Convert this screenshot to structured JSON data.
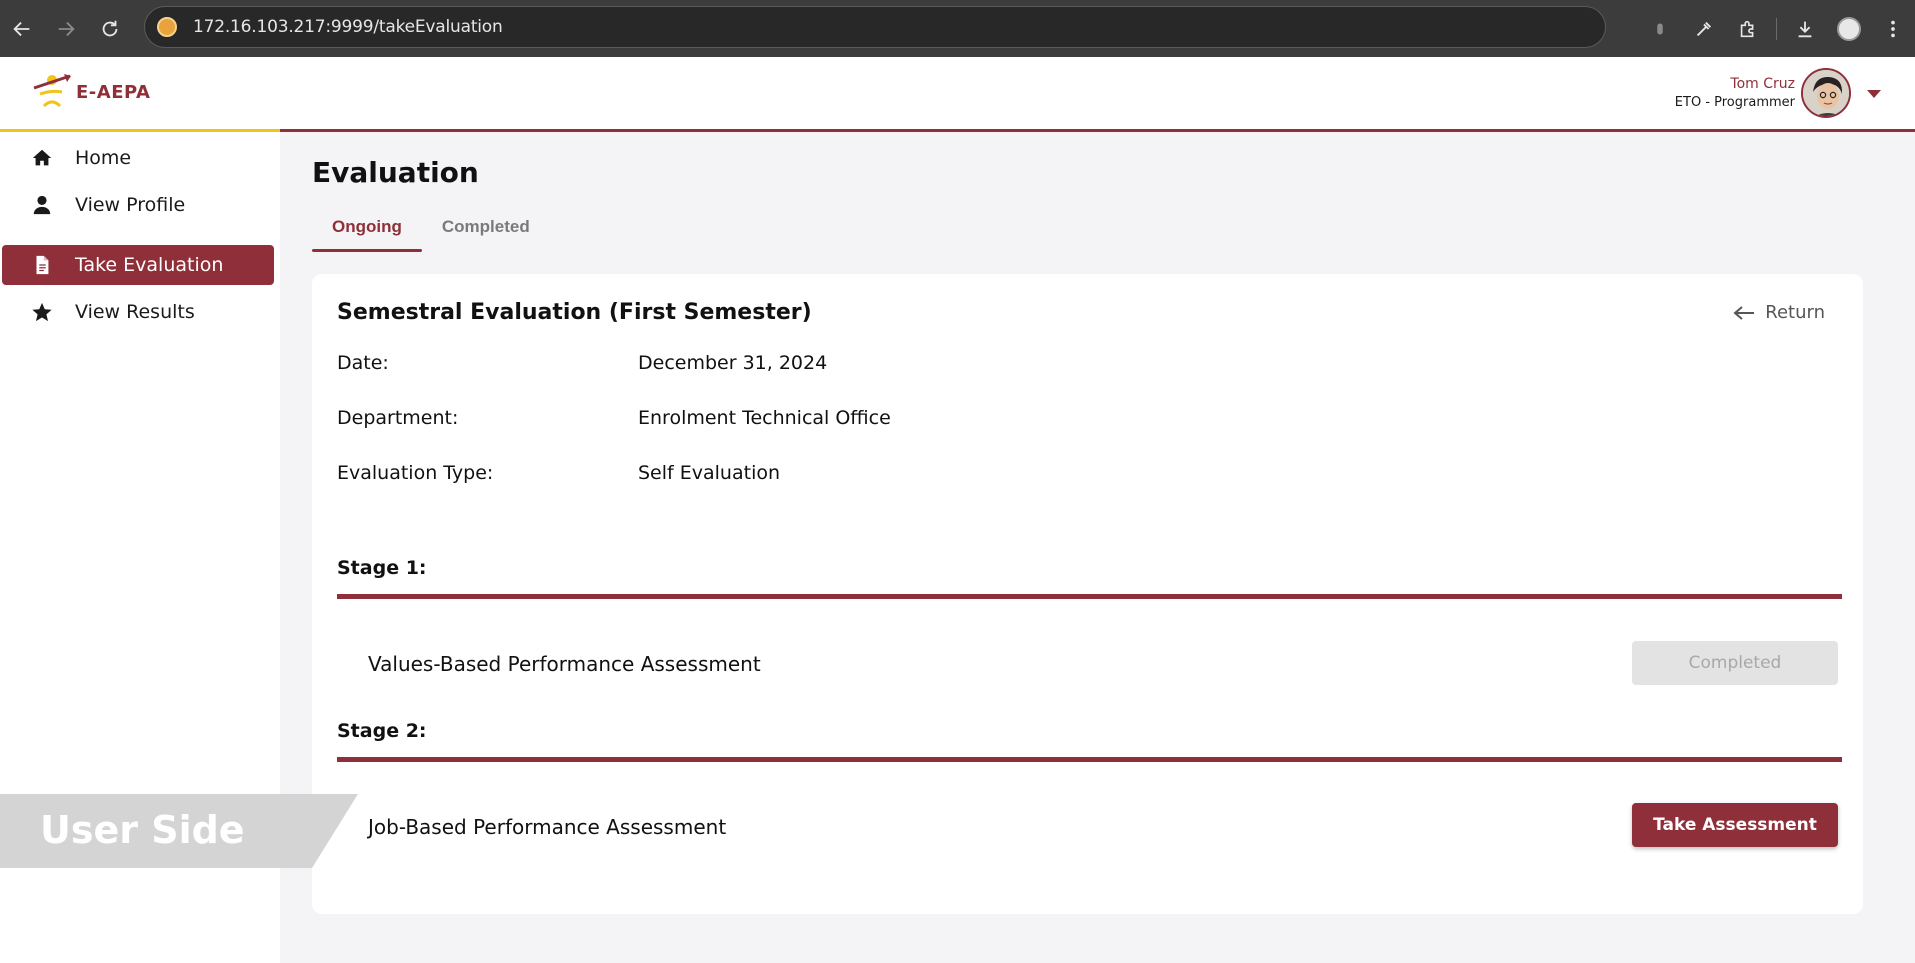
{
  "browser": {
    "url": "172.16.103.217:9999/takeEvaluation"
  },
  "app": {
    "logo_text": "E-AEPA",
    "user": {
      "name": "Tom Cruz",
      "role": "ETO - Programmer"
    }
  },
  "sidebar": {
    "items": [
      {
        "label": "Home",
        "icon": "home-icon",
        "active": false
      },
      {
        "label": "View Profile",
        "icon": "user-icon",
        "active": false
      },
      {
        "label": "Take Evaluation",
        "icon": "document-icon",
        "active": true
      },
      {
        "label": "View Results",
        "icon": "star-icon",
        "active": false
      }
    ]
  },
  "main": {
    "title": "Evaluation",
    "tabs": [
      {
        "label": "Ongoing",
        "active": true
      },
      {
        "label": "Completed",
        "active": false
      }
    ],
    "card": {
      "title": "Semestral Evaluation (First Semester)",
      "return_label": "Return",
      "details": [
        {
          "label": "Date:",
          "value": "December 31, 2024"
        },
        {
          "label": "Department:",
          "value": "Enrolment Technical Office"
        },
        {
          "label": "Evaluation Type:",
          "value": "Self Evaluation"
        }
      ],
      "stages": [
        {
          "label": "Stage 1:",
          "assessment": "Values-Based Performance Assessment",
          "button_label": "Completed",
          "button_state": "disabled"
        },
        {
          "label": "Stage 2:",
          "assessment": "Job-Based Performance Assessment",
          "button_label": "Take Assessment",
          "button_state": "enabled"
        }
      ]
    }
  },
  "banner": {
    "text": "User Side"
  },
  "colors": {
    "accent": "#8e2f39",
    "header_yellow": "#f2c418",
    "page_bg": "#f4f4f6",
    "disabled_bg": "#e3e3e3"
  }
}
